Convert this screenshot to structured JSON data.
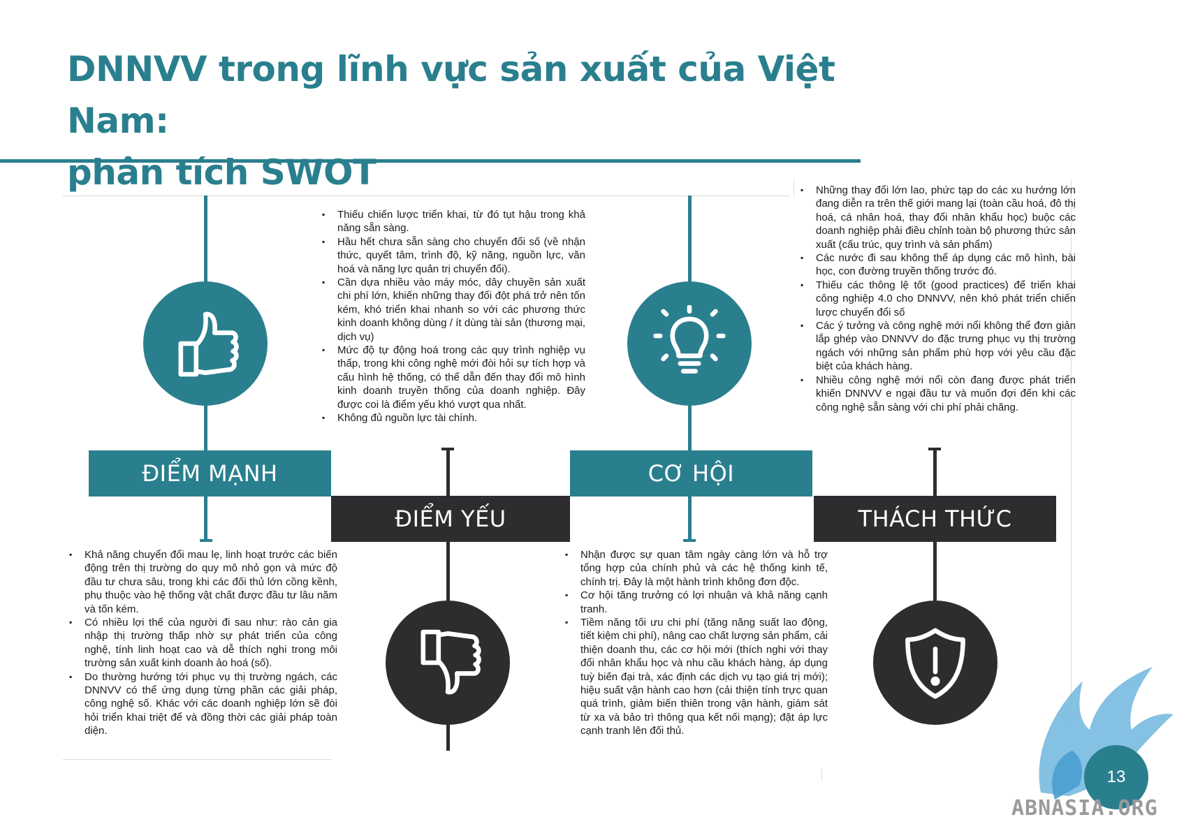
{
  "title": {
    "line1": "DNNVV trong lĩnh vực sản xuất của Việt Nam:",
    "line2": "phân tích SWOT"
  },
  "colors": {
    "accent": "#2a7f8e",
    "dark": "#2d2d30"
  },
  "swot": {
    "strengths": {
      "label": "ĐIỂM MẠNH",
      "icon": "thumbs-up-icon",
      "items": [
        "Khả năng chuyển đổi mau lẹ, linh hoạt trước các biến động trên thị trường do quy mô nhỏ gọn và mức độ đầu tư chưa sâu, trong khi các đối thủ lớn cồng kềnh, phụ thuộc vào hệ thống vật chất được đầu tư lâu năm và tốn kém.",
        "Có nhiều lợi thế của người đi sau như: rào cản gia nhập thị trường thấp nhờ sự phát triển của công nghệ, tính linh hoạt cao và dễ thích nghi trong môi trường sản xuất kinh doanh ảo hoá (số).",
        "Do thường hướng tới phục vụ thị trường ngách, các DNNVV có thể ứng dụng từng phần các giải pháp, công nghệ số. Khác với các doanh nghiệp lớn sẽ đòi hỏi  triển khai triệt để và đồng thời các giải pháp toàn diện."
      ]
    },
    "weaknesses": {
      "label": "ĐIỂM YẾU",
      "icon": "thumbs-down-icon",
      "items": [
        "Thiếu chiến lược triển khai, từ đó tụt hậu trong khả năng sẵn sàng.",
        "Hầu hết chưa sẵn sàng cho chuyển đổi số (về nhận thức, quyết tâm, trình độ, kỹ năng, nguồn lực, văn hoá và năng lực quản trị chuyển đổi).",
        "Cần dựa nhiều vào máy móc, dây chuyền sản xuất chi phí lớn, khiến những thay đổi đột phá trở nên tốn kém, khó triển khai nhanh so với các phương thức kinh doanh không dùng / ít dùng tài sản (thương mại, dịch vụ)",
        "Mức độ tự động hoá  trong các quy trình nghiệp vụ thấp, trong khi công nghệ mới đòi hỏi sự tích hợp và cấu hình hệ thống, có thể dẫn đến thay đổi mô hình kinh doanh truyền thống của doanh nghiệp. Đây được coi là điểm yếu khó vượt qua nhất.",
        "Không đủ nguồn lực tài chính."
      ]
    },
    "opportunities": {
      "label": "CƠ HỘI",
      "icon": "lightbulb-icon",
      "items": [
        "Nhận được sự quan tâm ngày càng lớn và hỗ trợ tổng hợp của chính phủ và các hệ thống kinh tế, chính trị. Đây là một hành trình không đơn độc.",
        "Cơ hội tăng trưởng có lợi nhuận và khả năng cạnh tranh.",
        "Tiềm năng tối ưu chi phí (tăng năng suất lao động, tiết kiệm chi phí), nâng cao chất lượng sản phẩm, cải thiện doanh thu, các cơ hội mới (thích nghi với thay đổi nhân khẩu học và nhu cầu khách hàng, áp dụng tuỳ biến đại trà, xác định các dịch vụ tạo giá trị mới); hiệu suất vận hành cao hơn (cải thiện tính trực quan quá trình, giảm biến thiên trong vận hành, giám sát từ xa và bảo trì thông qua kết nối mạng); đặt áp lực cạnh tranh lên đối thủ."
      ]
    },
    "threats": {
      "label": "THÁCH THỨC",
      "icon": "shield-alert-icon",
      "items": [
        "Những thay đổi lớn lao, phức tạp do các xu hướng lớn đang diễn ra trên thế giới mang lại (toàn cầu hoá, đô thị hoá, cá nhân hoá, thay đổi nhân khẩu học) buộc các doanh nghiệp phải điều chỉnh toàn bộ phương thức sản xuất (cấu trúc, quy trình và sản phẩm)",
        "Các nước đi sau không thể áp dụng các mô hình, bài học, con đường truyền thống trước đó.",
        "Thiếu các thông lệ tốt (good practices) để triển khai công nghiệp 4.0 cho DNNVV, nên khó phát triển chiến lược chuyển đổi số",
        "Các ý tưởng và công nghệ mới nổi không thể đơn giản lắp ghép vào DNNVV do đặc trưng phục vụ thị trường ngách với những sản phẩm phù hợp với yêu cầu đặc biệt của khách hàng.",
        "Nhiều công nghệ mới nổi còn đang được phát triển khiến DNNVV e ngại đầu tư và muốn đợi đến khi các công nghệ sẵn sàng với chi phí phải chăng."
      ]
    }
  },
  "footer": {
    "page_number": "13",
    "watermark": "ABNASIA.ORG",
    "logo_icon": "griffin-logo-icon"
  }
}
